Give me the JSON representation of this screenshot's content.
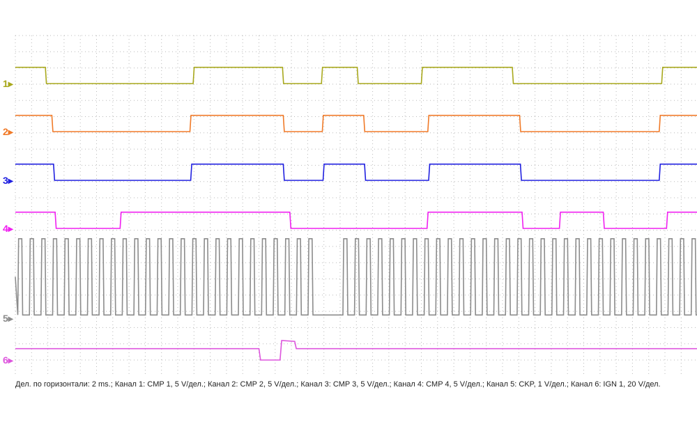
{
  "chart_data": {
    "type": "line",
    "title": "",
    "x_unit": "ms",
    "x_per_div": 2,
    "xlim": [
      0,
      84
    ],
    "grid": true,
    "caption": "Дел. по горизонтали: 2 ms.; Канал 1: CMP 1, 5 V/дел.; Канал 2: CMP 2, 5 V/дел.; Канал 3: CMP 3, 5 V/дел.; Канал 4: CMP 4, 5 V/дел.; Канал 5: CKP, 1 V/дел.; Канал 6: IGN 1, 20 V/дел.",
    "series": [
      {
        "id": "1",
        "name": "CMP 1",
        "volts_per_div": 5,
        "color": "#a8a81c",
        "type": "digital",
        "low_v": 0,
        "high_v": 5,
        "initial": "high",
        "transitions_ms": [
          3.7,
          21.9,
          32.9,
          37.7,
          42.1,
          50.0,
          61.2,
          79.6
        ]
      },
      {
        "id": "2",
        "name": "CMP 2",
        "volts_per_div": 5,
        "color": "#f07a28",
        "type": "digital",
        "low_v": 0,
        "high_v": 5,
        "initial": "high",
        "transitions_ms": [
          4.5,
          21.5,
          33.0,
          37.8,
          42.9,
          50.8,
          62.1,
          79.3
        ]
      },
      {
        "id": "3",
        "name": "CMP 3",
        "volts_per_div": 5,
        "color": "#2020e0",
        "type": "digital",
        "low_v": 0,
        "high_v": 5,
        "initial": "high",
        "transitions_ms": [
          4.7,
          21.6,
          33.0,
          37.9,
          43.0,
          50.9,
          62.2,
          79.3
        ]
      },
      {
        "id": "4",
        "name": "CMP 4",
        "volts_per_div": 5,
        "color": "#f020f0",
        "type": "digital",
        "low_v": 0,
        "high_v": 5,
        "initial": "high",
        "transitions_ms": [
          4.9,
          12.9,
          33.8,
          50.7,
          62.4,
          67.0,
          72.4,
          80.2
        ]
      },
      {
        "id": "5",
        "name": "CKP",
        "volts_per_div": 1,
        "color": "#8c8c8c",
        "type": "teeth",
        "low_v": 0.2,
        "high_v": 4.9,
        "first_tooth_ms": 0.4,
        "tooth_period_ms": 1.43,
        "missing_teeth_index": [
          26,
          27
        ]
      },
      {
        "id": "6",
        "name": "IGN 1",
        "volts_per_div": 20,
        "color": "#dd55dd",
        "type": "segments",
        "baseline_v": 14,
        "points_ms_v": [
          [
            0,
            14
          ],
          [
            30.0,
            14
          ],
          [
            30.2,
            0
          ],
          [
            32.6,
            0
          ],
          [
            32.8,
            24
          ],
          [
            34.4,
            23
          ],
          [
            34.6,
            14
          ],
          [
            84,
            14
          ]
        ]
      }
    ]
  }
}
